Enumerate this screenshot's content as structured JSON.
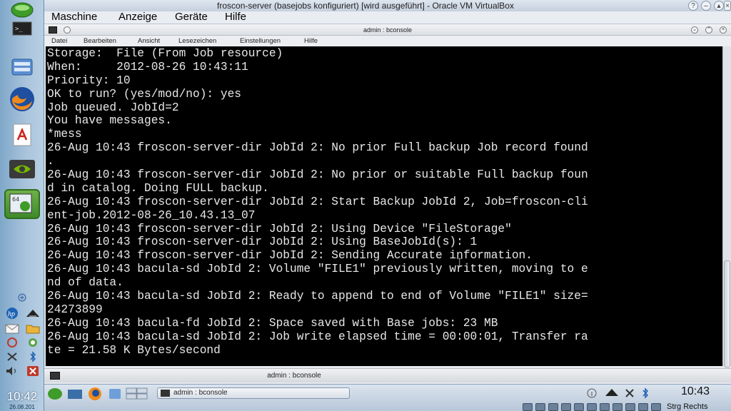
{
  "host_clock": {
    "time": "10:42",
    "date": "26.08.201"
  },
  "vbox": {
    "title": "froscon-server (basejobs konfiguriert) [wird ausgeführt] - Oracle VM VirtualBox",
    "menu": [
      "Maschine",
      "Anzeige",
      "Geräte",
      "Hilfe"
    ]
  },
  "konsole": {
    "title": "admin : bconsole",
    "menu": [
      "Datei",
      "Bearbeiten",
      "Ansicht",
      "Lesezeichen",
      "Einstellungen",
      "Hilfe"
    ],
    "tab_label": "admin : bconsole"
  },
  "terminal_lines": [
    "Storage:  File (From Job resource)",
    "When:     2012-08-26 10:43:11",
    "Priority: 10",
    "OK to run? (yes/mod/no): yes",
    "Job queued. JobId=2",
    "You have messages.",
    "*mess",
    "26-Aug 10:43 froscon-server-dir JobId 2: No prior Full backup Job record found",
    ".",
    "26-Aug 10:43 froscon-server-dir JobId 2: No prior or suitable Full backup foun",
    "d in catalog. Doing FULL backup.",
    "26-Aug 10:43 froscon-server-dir JobId 2: Start Backup JobId 2, Job=froscon-cli",
    "ent-job.2012-08-26_10.43.13_07",
    "26-Aug 10:43 froscon-server-dir JobId 2: Using Device \"FileStorage\"",
    "26-Aug 10:43 froscon-server-dir JobId 2: Using BaseJobId(s): 1",
    "26-Aug 10:43 froscon-server-dir JobId 2: Sending Accurate information.",
    "26-Aug 10:43 bacula-sd JobId 2: Volume \"FILE1\" previously written, moving to e",
    "nd of data.",
    "26-Aug 10:43 bacula-sd JobId 2: Ready to append to end of Volume \"FILE1\" size=",
    "24273899",
    "26-Aug 10:43 bacula-fd JobId 2: Space saved with Base jobs: 23 MB",
    "26-Aug 10:43 bacula-sd JobId 2: Job write elapsed time = 00:00:01, Transfer ra",
    "te = 21.58 K Bytes/second"
  ],
  "guest_taskbar": {
    "task_label": "admin : bconsole",
    "clock": "10:43"
  },
  "status_bar": {
    "host_key": "Strg Rechts"
  }
}
